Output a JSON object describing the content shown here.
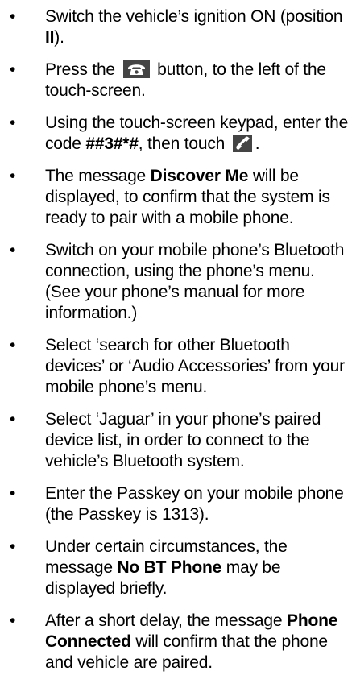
{
  "colors": {
    "text": "#000000",
    "icon_box": "#444444",
    "icon_glyph": "#ffffff"
  },
  "icons": {
    "phone_button": "phone-handset-icon",
    "call_send": "handset-call-icon"
  },
  "bullet": "•",
  "steps": [
    {
      "t1": "Switch the vehicle’s ignition ON (position ",
      "b1": "II",
      "t2": ")."
    },
    {
      "t1": "Press the ",
      "t2": " button, to the left of the touch-screen."
    },
    {
      "t1": "Using the touch-screen keypad, enter the code ",
      "b1": "##3#*#",
      "t2": ", then touch ",
      "t3": "."
    },
    {
      "t1": "The message ",
      "b1": "Discover Me",
      "t2": " will be displayed, to confirm that the system is ready to pair with a mobile phone."
    },
    {
      "t1": "Switch on your mobile phone’s Bluetooth connection, using the phone’s menu. (See your phone’s manual for more information.)"
    },
    {
      "t1": "Select ‘search for other Bluetooth devices’ or ‘Audio Accessories’ from your mobile phone’s menu."
    },
    {
      "t1": "Select ‘Jaguar’ in your phone’s paired device list, in order to connect to the vehicle’s Bluetooth system."
    },
    {
      "t1": "Enter the Passkey on your mobile phone (the Passkey is 1313)."
    },
    {
      "t1": "Under certain circumstances, the message ",
      "b1": "No BT Phone",
      "t2": " may be displayed briefly."
    },
    {
      "t1": "After a short delay, the message ",
      "b1": "Phone Connected",
      "t2": " will confirm that the phone and vehicle are paired."
    }
  ]
}
